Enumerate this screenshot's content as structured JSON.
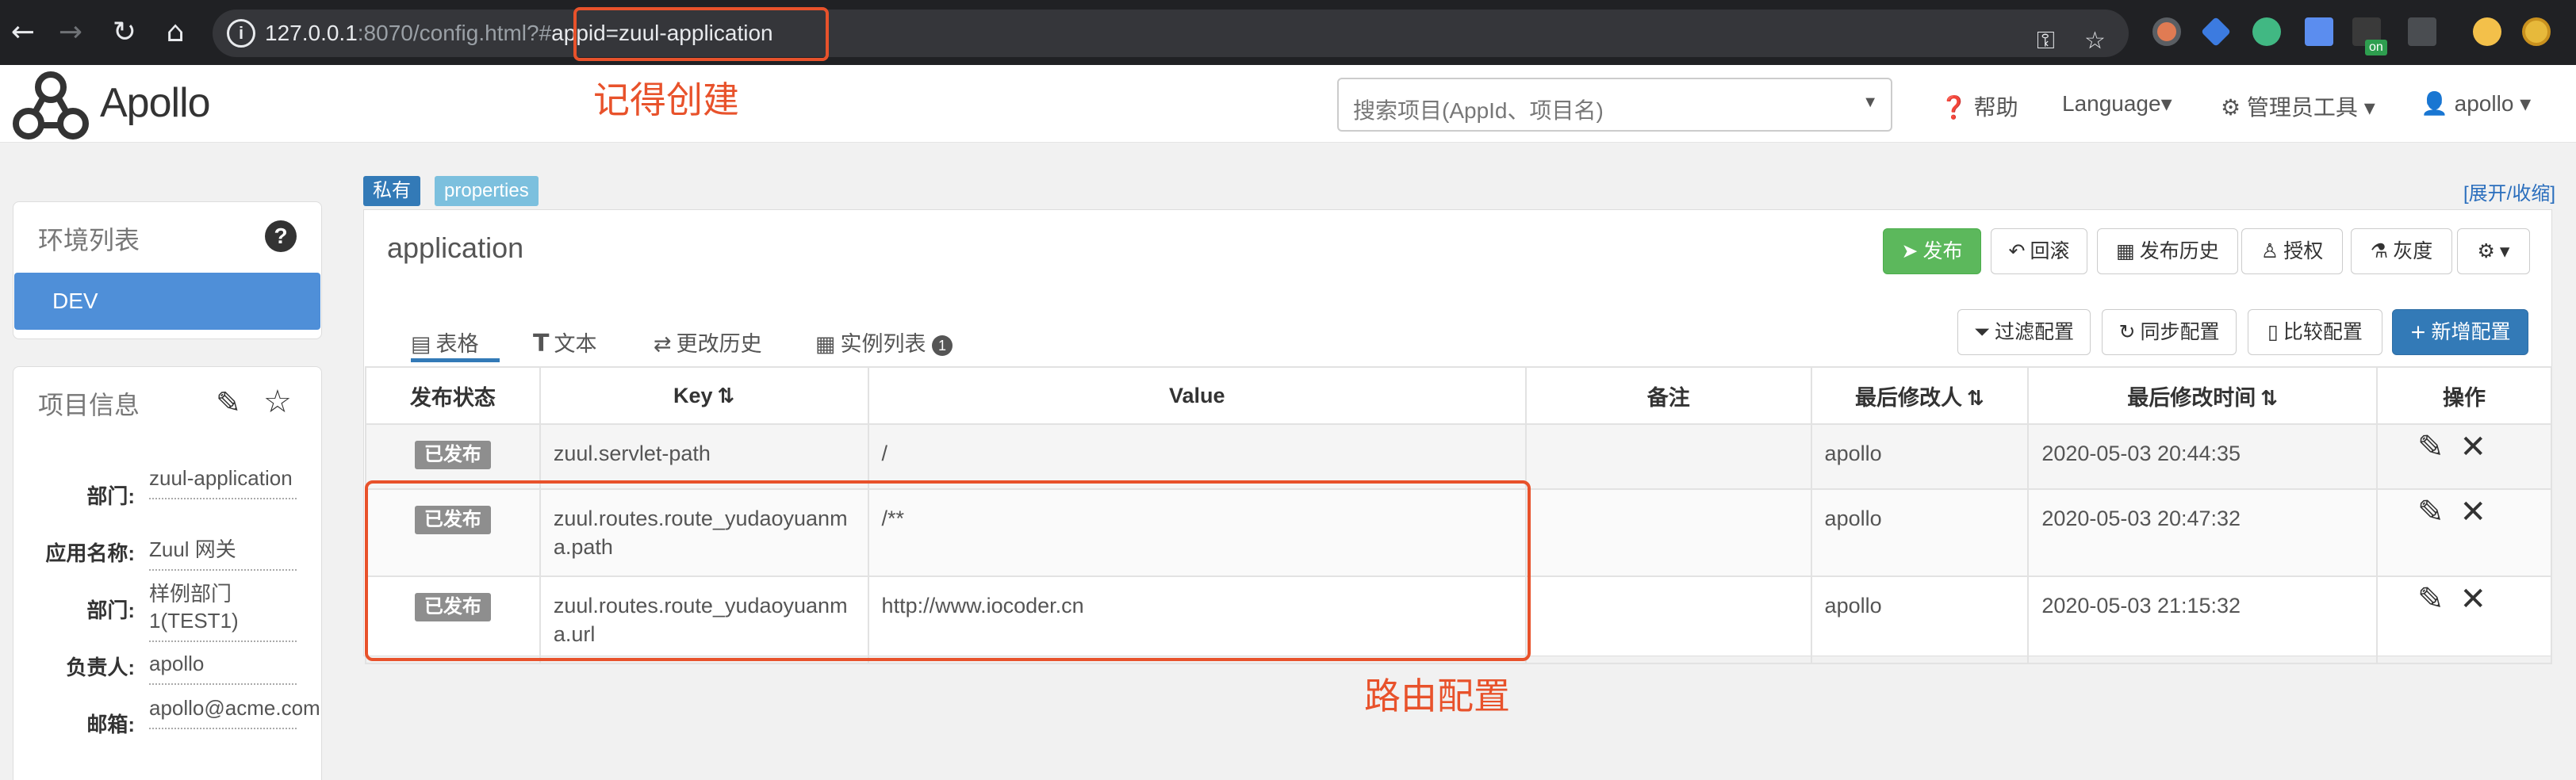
{
  "browser": {
    "url_host": "127.0.0.1",
    "url_rest": ":8070/config.html?#",
    "url_fragment": "appid=zuul-application",
    "on_badge": "on"
  },
  "annotations": {
    "remember_create": "记得创建",
    "route_config": "路由配置"
  },
  "header": {
    "brand": "Apollo",
    "search_placeholder": "搜索项目(AppId、项目名)",
    "help": "帮助",
    "language": "Language",
    "admin_tools": "管理员工具",
    "user": "apollo"
  },
  "sidebar": {
    "env_title": "环境列表",
    "env_items": [
      "DEV"
    ],
    "project_title": "项目信息",
    "info": [
      {
        "label": "部门:",
        "value": "zuul-application"
      },
      {
        "label": "应用名称:",
        "value": "Zuul 网关"
      },
      {
        "label": "部门:",
        "value": "样例部门1(TEST1)"
      },
      {
        "label": "负责人:",
        "value": "apollo"
      },
      {
        "label": "邮箱:",
        "value": "apollo@acme.com"
      }
    ]
  },
  "namespace": {
    "tag_private": "私有",
    "tag_format": "properties",
    "expand_toggle": "[展开/收缩]",
    "name": "application",
    "actions": {
      "publish": "发布",
      "rollback": "回滚",
      "history": "发布历史",
      "authorize": "授权",
      "gray": "灰度"
    },
    "tabs": {
      "table": "表格",
      "text": "文本",
      "change_history": "更改历史",
      "instances": "实例列表",
      "instances_count": "1"
    },
    "tools": {
      "filter": "过滤配置",
      "sync": "同步配置",
      "compare": "比较配置",
      "add": "新增配置"
    },
    "table": {
      "headers": [
        "发布状态",
        "Key",
        "Value",
        "备注",
        "最后修改人",
        "最后修改时间",
        "操作"
      ],
      "rows": [
        {
          "status": "已发布",
          "key": "zuul.servlet-path",
          "value": "/",
          "comment": "",
          "modifier": "apollo",
          "time": "2020-05-03 20:44:35"
        },
        {
          "status": "已发布",
          "key": "zuul.routes.route_yudaoyuanma.path",
          "value": "/**",
          "comment": "",
          "modifier": "apollo",
          "time": "2020-05-03 20:47:32"
        },
        {
          "status": "已发布",
          "key": "zuul.routes.route_yudaoyuanma.url",
          "value": "http://www.iocoder.cn",
          "comment": "",
          "modifier": "apollo",
          "time": "2020-05-03 21:15:32"
        }
      ]
    }
  }
}
